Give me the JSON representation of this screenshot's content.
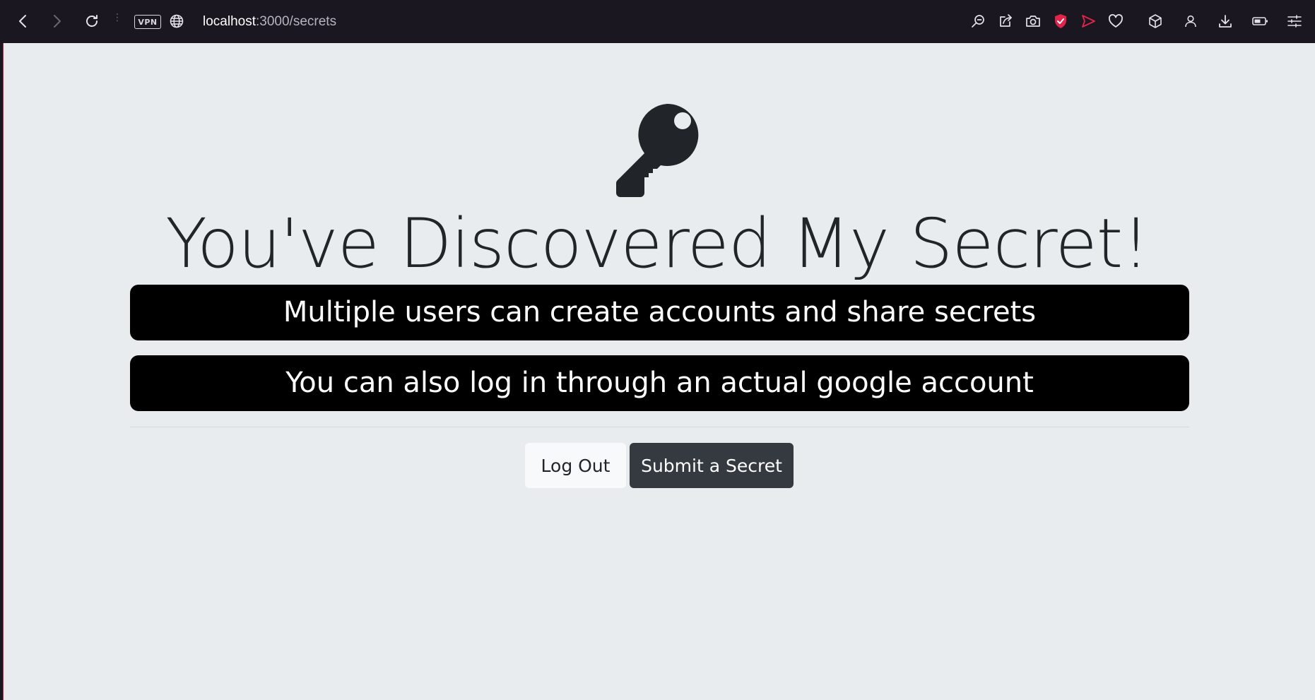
{
  "browser": {
    "vpn_label": "VPN",
    "url_host": "localhost",
    "url_path": ":3000/secrets",
    "accent_color": "#e0244b",
    "toolbar_left_icons": [
      "back-icon",
      "forward-icon",
      "reload-icon",
      "globe-icon"
    ],
    "toolbar_right_icons": [
      "search-page-icon",
      "share-icon",
      "camera-icon",
      "shield-icon",
      "send-icon",
      "heart-icon",
      "cube-icon",
      "profile-icon",
      "download-icon",
      "battery-icon",
      "menu-icon"
    ]
  },
  "page": {
    "icon": "key-icon",
    "title": "You've Discovered My Secret!",
    "secrets": [
      "Multiple users can create accounts and share secrets",
      "You can also log in through an actual google account"
    ],
    "logout_label": "Log Out",
    "submit_label": "Submit a Secret",
    "background_color": "#e9ecef",
    "text_color": "#212529",
    "card_color": "#000000",
    "dark_button_color": "#343a40",
    "light_button_color": "#f8f9fa"
  }
}
